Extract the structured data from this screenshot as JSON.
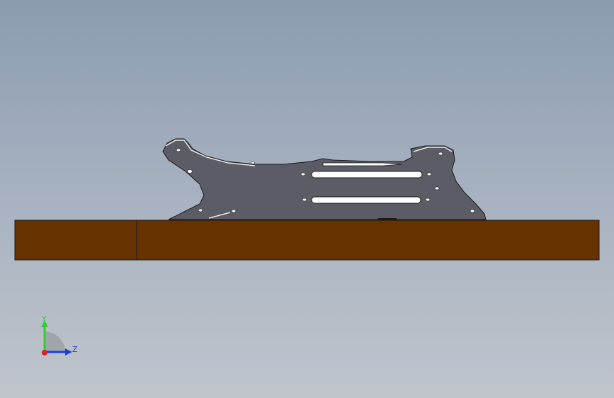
{
  "view": {
    "background_top": "#8b9bb0",
    "background_bottom": "#c0c5cc"
  },
  "model": {
    "board_color": "#663300",
    "plate_color": "#5c5c66",
    "slot_color": "#ffffff"
  },
  "triad": {
    "y_label": "Y",
    "z_label": "Z",
    "y_color": "#33cc33",
    "z_color": "#1f3fd6",
    "x_color": "#e02020"
  }
}
